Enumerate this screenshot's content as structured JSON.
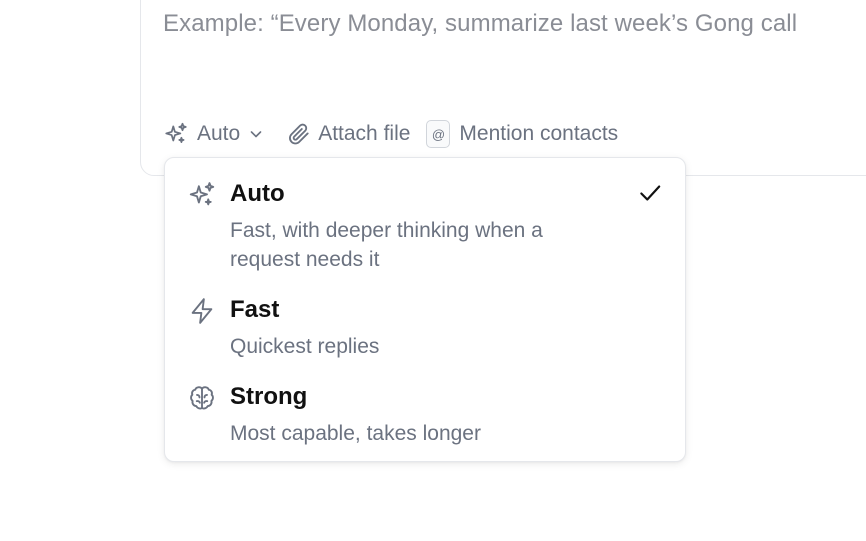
{
  "composer": {
    "placeholder": "Example: “Every Monday, summarize last week’s Gong call"
  },
  "toolbar": {
    "model_label": "Auto",
    "model_icon": "sparkles-icon",
    "attach_label": "Attach file",
    "attach_icon": "paperclip-icon",
    "mention_symbol": "@",
    "mention_label": "Mention contacts"
  },
  "model_menu": {
    "selected": "Auto",
    "options": [
      {
        "title": "Auto",
        "description": "Fast, with deeper thinking when a request needs it",
        "icon": "sparkles-icon",
        "selected": true
      },
      {
        "title": "Fast",
        "description": "Quickest replies",
        "icon": "lightning-icon",
        "selected": false
      },
      {
        "title": "Strong",
        "description": "Most capable, takes longer",
        "icon": "brain-icon",
        "selected": false
      }
    ]
  },
  "colors": {
    "muted_text": "#6b7280",
    "placeholder_text": "#8a8d95",
    "primary_text": "#111111",
    "border": "#e5e7eb"
  }
}
